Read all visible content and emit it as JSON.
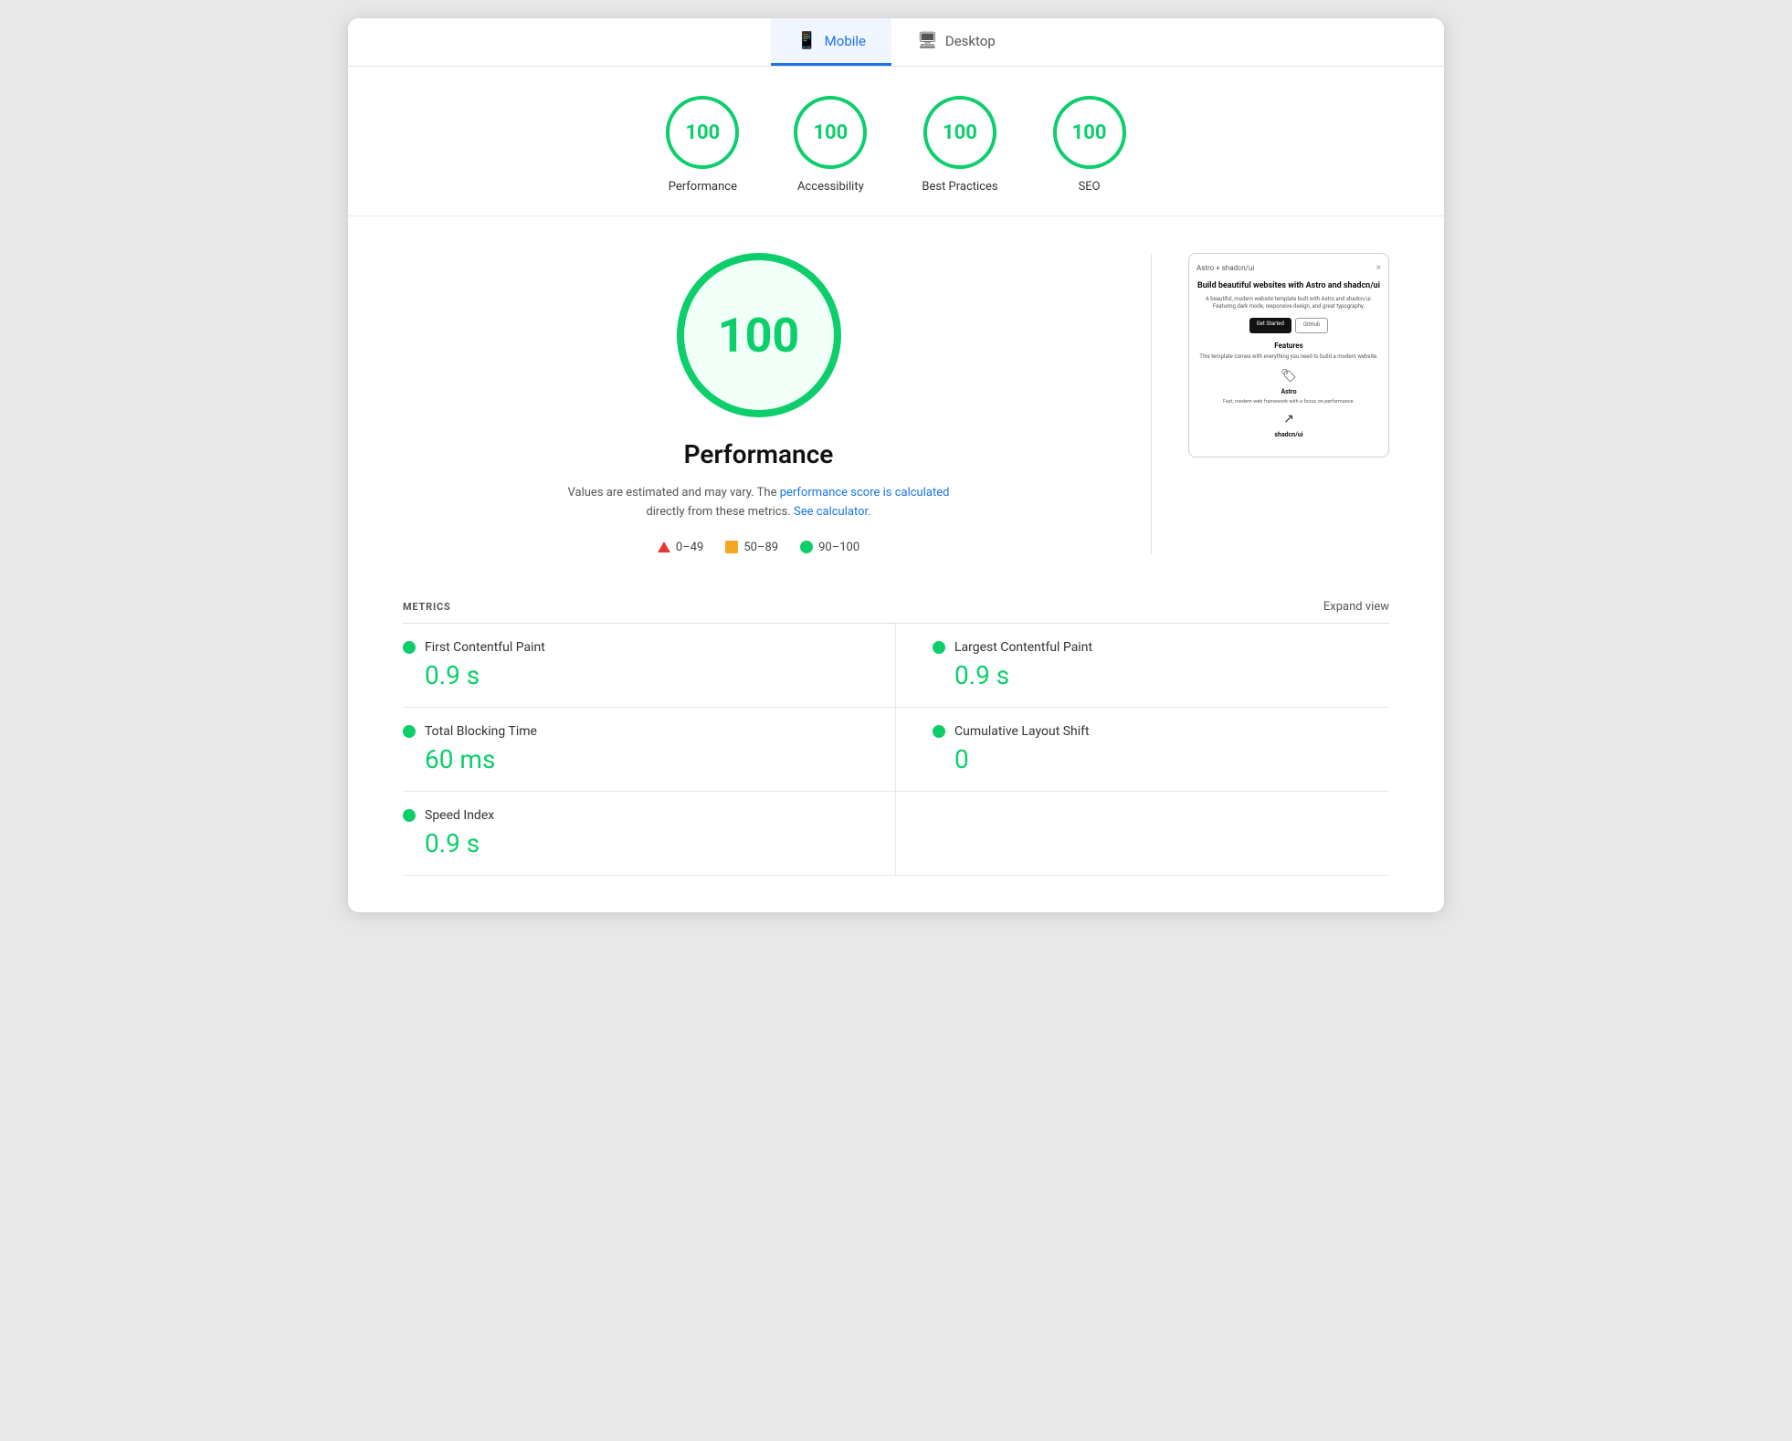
{
  "tabs": [
    {
      "id": "mobile",
      "label": "Mobile",
      "active": true,
      "icon": "📱"
    },
    {
      "id": "desktop",
      "label": "Desktop",
      "active": false,
      "icon": "🖥"
    }
  ],
  "scores": [
    {
      "id": "performance",
      "label": "Performance",
      "value": "100"
    },
    {
      "id": "accessibility",
      "label": "Accessibility",
      "value": "100"
    },
    {
      "id": "best-practices",
      "label": "Best Practices",
      "value": "100"
    },
    {
      "id": "seo",
      "label": "SEO",
      "value": "100"
    }
  ],
  "main": {
    "big_score": "100",
    "section_title": "Performance",
    "description_text": "Values are estimated and may vary. The ",
    "link1_text": "performance score is calculated",
    "description_middle": " directly from these metrics. ",
    "link2_text": "See calculator",
    "description_end": ".",
    "legend": [
      {
        "type": "triangle",
        "range": "0–49"
      },
      {
        "type": "square",
        "range": "50–89"
      },
      {
        "type": "circle",
        "range": "90–100"
      }
    ]
  },
  "screenshot": {
    "title": "Astro + shadcn/ui",
    "close": "×",
    "heading": "Build beautiful websites with Astro and shadcn/ui",
    "desc": "A beautiful, modern website template built with Astro and shadcn/ui. Featuring dark mode, responsive design, and great typography.",
    "btn1": "Get Started",
    "btn2": "GitHub",
    "features_title": "Features",
    "features_desc": "This template comes with everything you need to build a modern website.",
    "icon_title": "Astro",
    "icon_desc": "Fast, modern web framework with a focus on performance.",
    "icon2_title": "shadcn/ui"
  },
  "metrics": {
    "header_label": "METRICS",
    "expand_label": "Expand view",
    "items": [
      {
        "name": "First Contentful Paint",
        "value": "0.9 s"
      },
      {
        "name": "Largest Contentful Paint",
        "value": "0.9 s"
      },
      {
        "name": "Total Blocking Time",
        "value": "60 ms"
      },
      {
        "name": "Cumulative Layout Shift",
        "value": "0"
      },
      {
        "name": "Speed Index",
        "value": "0.9 s"
      },
      {
        "name": "",
        "value": ""
      }
    ]
  }
}
